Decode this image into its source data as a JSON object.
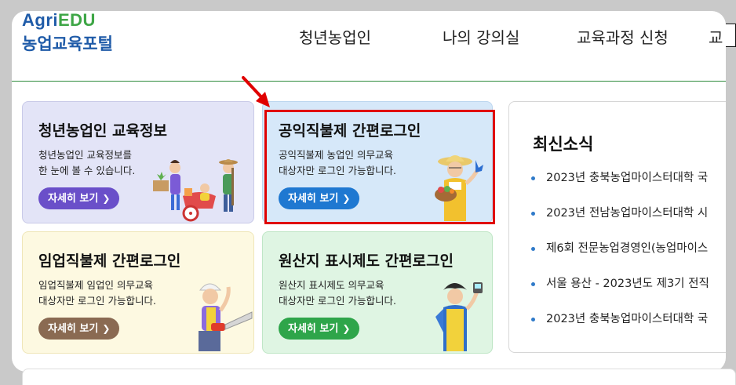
{
  "logo": {
    "brand_prefix": "Agri",
    "brand_suffix": "EDU",
    "portal_name": "농업교육포털"
  },
  "nav": [
    "청년농업인",
    "나의 강의실",
    "교육과정 신청",
    "교"
  ],
  "cards": [
    {
      "title": "청년농업인 교육정보",
      "desc_line1": "청년농업인 교육정보를",
      "desc_line2": "한 눈에 볼 수 있습니다.",
      "button": "자세히 보기"
    },
    {
      "title": "공익직불제 간편로그인",
      "desc_line1": "공익직불제 농업인 의무교육",
      "desc_line2": "대상자만 로그인 가능합니다.",
      "button": "자세히 보기"
    },
    {
      "title": "임업직불제 간편로그인",
      "desc_line1": "임업직불제 임업인 의무교육",
      "desc_line2": "대상자만 로그인 가능합니다.",
      "button": "자세히 보기"
    },
    {
      "title": "원산지 표시제도 간편로그인",
      "desc_line1": "원산지 표시제도 의무교육",
      "desc_line2": "대상자만 로그인 가능합니다.",
      "button": "자세히 보기"
    }
  ],
  "news": {
    "title": "최신소식",
    "items": [
      "2023년 충북농업마이스터대학 국",
      "2023년 전남농업마이스터대학 시",
      "제6회 전문농업경영인(농업마이스",
      "서울 용산 - 2023년도 제3기 전직",
      "2023년 충북농업마이스터대학 국"
    ]
  },
  "colors": {
    "brand_blue": "#1f5ba8",
    "brand_green": "#3ea646",
    "highlight_red": "#e00000",
    "card1_bg": "#e3e4f7",
    "card1_btn": "#6a4fc9",
    "card2_bg": "#d6e8f9",
    "card2_btn": "#1f78d1",
    "card3_bg": "#fdf9e1",
    "card3_btn": "#8a6a52",
    "card4_bg": "#dff5e3",
    "card4_btn": "#2ea54a"
  }
}
